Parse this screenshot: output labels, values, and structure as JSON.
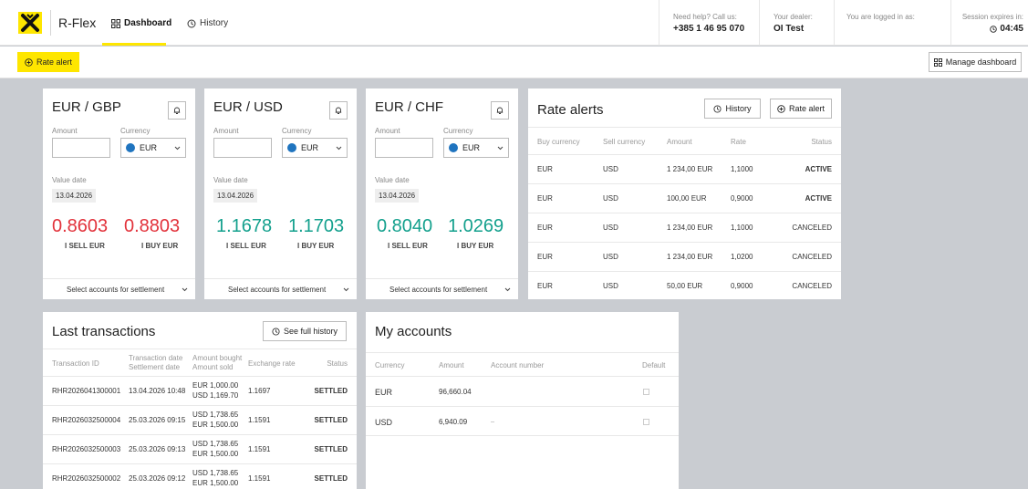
{
  "brand": {
    "name": "R-Flex"
  },
  "nav": [
    {
      "label": "Dashboard",
      "icon": "grid-icon",
      "active": true
    },
    {
      "label": "History",
      "icon": "history-icon",
      "active": false
    }
  ],
  "header": {
    "help_label": "Need help? Call us:",
    "help_phone": "+385 1 46 95 070",
    "dealer_label": "Your dealer:",
    "dealer_name": "OI Test",
    "login_label": "You are logged in as:",
    "session_label": "Session expires in:",
    "session_time": "04:45"
  },
  "toolbar": {
    "rate_alert_label": "Rate alert",
    "manage_label": "Manage dashboard"
  },
  "colors": {
    "accent": "#fee600",
    "sell_red": "#e2323b",
    "rate_green": "#13a08d",
    "active_blue": "#1a87c8",
    "currency_dot": "#1f74bf"
  },
  "fx_cards": [
    {
      "pair": "EUR / GBP",
      "amount_label": "Amount",
      "currency_label": "Currency",
      "currency": "EUR",
      "value_date_label": "Value date",
      "value_date": "13.04.2026",
      "sell_rate": "0.8603",
      "buy_rate": "0.8803",
      "sell_label": "I SELL EUR",
      "buy_label": "I BUY EUR",
      "sell_color": "red",
      "buy_color": "red",
      "settlement_label": "Select accounts for settlement"
    },
    {
      "pair": "EUR / USD",
      "amount_label": "Amount",
      "currency_label": "Currency",
      "currency": "EUR",
      "value_date_label": "Value date",
      "value_date": "13.04.2026",
      "sell_rate": "1.1678",
      "buy_rate": "1.1703",
      "sell_label": "I SELL EUR",
      "buy_label": "I BUY EUR",
      "sell_color": "green",
      "buy_color": "green",
      "settlement_label": "Select accounts for settlement"
    },
    {
      "pair": "EUR / CHF",
      "amount_label": "Amount",
      "currency_label": "Currency",
      "currency": "EUR",
      "value_date_label": "Value date",
      "value_date": "13.04.2026",
      "sell_rate": "0.8040",
      "buy_rate": "1.0269",
      "sell_label": "I SELL EUR",
      "buy_label": "I BUY EUR",
      "sell_color": "green",
      "buy_color": "green",
      "settlement_label": "Select accounts for settlement"
    }
  ],
  "rate_alerts": {
    "title": "Rate alerts",
    "history_label": "History",
    "rate_alert_label": "Rate alert",
    "columns": [
      "Buy currency",
      "Sell currency",
      "Amount",
      "Rate",
      "Status"
    ],
    "rows": [
      {
        "buy": "EUR",
        "sell": "USD",
        "amount": "1 234,00 EUR",
        "rate": "1,1000",
        "status": "ACTIVE"
      },
      {
        "buy": "EUR",
        "sell": "USD",
        "amount": "100,00 EUR",
        "rate": "0,9000",
        "status": "ACTIVE"
      },
      {
        "buy": "EUR",
        "sell": "USD",
        "amount": "1 234,00 EUR",
        "rate": "1,1000",
        "status": "CANCELED"
      },
      {
        "buy": "EUR",
        "sell": "USD",
        "amount": "1 234,00 EUR",
        "rate": "1,0200",
        "status": "CANCELED"
      },
      {
        "buy": "EUR",
        "sell": "USD",
        "amount": "50,00 EUR",
        "rate": "0,9000",
        "status": "CANCELED"
      }
    ]
  },
  "transactions": {
    "title": "Last transactions",
    "full_history_label": "See full history",
    "columns": {
      "id": "Transaction ID",
      "dates_1": "Transaction date",
      "dates_2": "Settlement date",
      "amounts_1": "Amount bought",
      "amounts_2": "Amount sold",
      "rate": "Exchange rate",
      "status": "Status"
    },
    "rows": [
      {
        "id": "RHR2026041300001",
        "date": "13.04.2026 10:48",
        "bought": "EUR 1,000.00",
        "sold": "USD 1,169.70",
        "rate": "1.1697",
        "status": "SETTLED"
      },
      {
        "id": "RHR2026032500004",
        "date": "25.03.2026 09:15",
        "bought": "USD 1,738.65",
        "sold": "EUR 1,500.00",
        "rate": "1.1591",
        "status": "SETTLED"
      },
      {
        "id": "RHR2026032500003",
        "date": "25.03.2026 09:13",
        "bought": "USD 1,738.65",
        "sold": "EUR 1,500.00",
        "rate": "1.1591",
        "status": "SETTLED"
      },
      {
        "id": "RHR2026032500002",
        "date": "25.03.2026 09:12",
        "bought": "USD 1,738.65",
        "sold": "EUR 1,500.00",
        "rate": "1.1591",
        "status": "SETTLED"
      }
    ]
  },
  "accounts": {
    "title": "My accounts",
    "columns": [
      "Currency",
      "Amount",
      "Account number",
      "Default"
    ],
    "rows": [
      {
        "currency": "EUR",
        "amount": "96,660.04"
      },
      {
        "currency": "USD",
        "amount": "6,940.09"
      }
    ]
  }
}
